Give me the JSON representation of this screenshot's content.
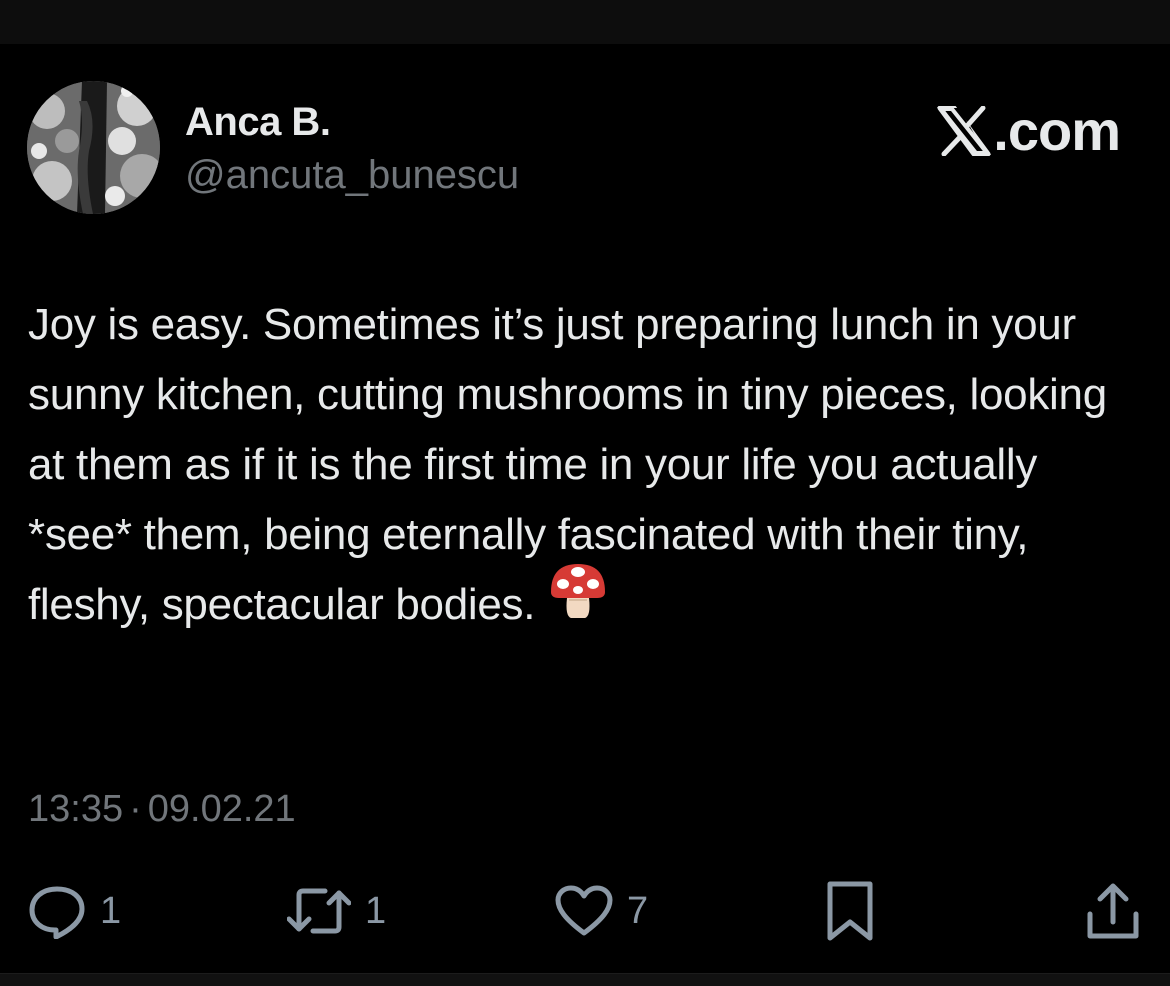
{
  "author": {
    "display_name": "Anca B.",
    "handle": "@ancuta_bunescu",
    "avatar_icon": "profile-photo"
  },
  "brand": {
    "logo_icon": "x-logo-icon",
    "label": ".com"
  },
  "tweet": {
    "text": "Joy is easy. Sometimes it’s just preparing lunch in your sunny kitchen, cutting mushrooms in tiny pieces, looking at them as if it is the first time in your life you actually *see* them, being eternally fascinated with their tiny, fleshy, spectacular bodies.",
    "emoji": "mushroom-emoji",
    "time": "13:35",
    "separator": "·",
    "date": "09.02.21"
  },
  "actions": {
    "reply": {
      "icon": "reply-icon",
      "count": "1"
    },
    "retweet": {
      "icon": "retweet-icon",
      "count": "1"
    },
    "like": {
      "icon": "heart-icon",
      "count": "7"
    },
    "bookmark": {
      "icon": "bookmark-icon"
    },
    "share": {
      "icon": "share-icon"
    }
  },
  "colors": {
    "background": "#000000",
    "primary_text": "#e7e9ea",
    "secondary_text": "#71767b",
    "icon": "#8b98a5",
    "mushroom_cap": "#d63a35",
    "mushroom_stem": "#f2d9c2"
  }
}
